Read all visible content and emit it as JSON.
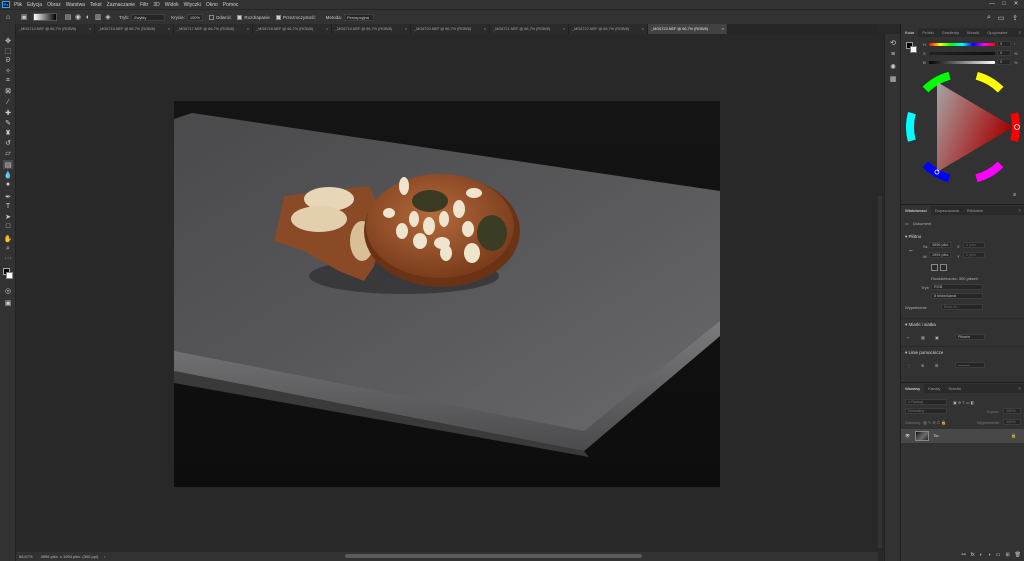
{
  "app": {
    "logo": "Ps"
  },
  "menu": [
    "Plik",
    "Edycja",
    "Obraz",
    "Warstwa",
    "Tekst",
    "Zaznaczanie",
    "Filtr",
    "3D",
    "Widok",
    "Wtyczki",
    "Okno",
    "Pomoc"
  ],
  "window_controls": [
    "—",
    "□",
    "✕"
  ],
  "options": {
    "mode_label": "Tryb:",
    "mode_value": "Zwykły",
    "opacity_label": "Krycie:",
    "opacity_value": "100%",
    "reverse_label": "Odwróć",
    "dither_label": "Rozdrapanie",
    "transparency_label": "Przezroczystość",
    "method_label": "Metoda:",
    "method_value": "Percepcyjna"
  },
  "tabs": [
    "_MG6714.NEF @ 66,7% (RGB/8)",
    "_MG6716.NEF @ 66,7% (RGB/8)",
    "_MG6717.NEF @ 66,7% (RGB/8)",
    "_MG6718.NEF @ 66,7% (RGB/8)",
    "_MG6719.NEF @ 66,7% (RGB/8)",
    "_MG6720.NEF @ 66,7% (RGB/8)",
    "_MG6721.NEF @ 66,7% (RGB/8)",
    "_MG6722.NEF @ 66,7% (RGB/8)",
    "_MG6723.NEF @ 66,7% (RGB/8)"
  ],
  "active_tab_index": 8,
  "status": {
    "zoom": "66,67%",
    "doc_size": "3996 pikx. x 1994 pikx. (300 ppi)",
    "arrow": "›"
  },
  "color_panel": {
    "tabs": [
      "Kolor",
      "Próbki",
      "Gradienty",
      "Wzorki",
      "Opcjonalne"
    ],
    "active": 0,
    "sliders": [
      {
        "label": "H",
        "value": "0"
      },
      {
        "label": "S",
        "value": "0"
      },
      {
        "label": "B",
        "value": "0"
      }
    ],
    "percent": "%"
  },
  "properties_panel": {
    "tabs": [
      "Właściwości",
      "Dopasowania",
      "Biblioteki"
    ],
    "active": 0,
    "doc_label": "Dokument",
    "canvas_section": "Płótno",
    "w_label": "Sz",
    "w_value": "3996 pikx.",
    "h_label": "W",
    "h_value": "1994 pikx.",
    "x_label": "X",
    "y_label": "Y",
    "x_value": "0 pikx.",
    "y_value": "0 pikx.",
    "resolution": "Rozdzielczość: 300 pikseli",
    "mode_label": "Tryb",
    "mode_value": "RGB",
    "depth_value": "8 bitów/kanał",
    "fill_label": "Wypełnienie",
    "fill_value": "Białe tło",
    "rulers_section": "Miarki i siatka",
    "rulers_value": "Piksele",
    "guides_section": "Linie pomocnicze"
  },
  "layers_panel": {
    "tabs": [
      "Warstwy",
      "Kanały",
      "Ścieżki"
    ],
    "active": 0,
    "search_placeholder": "Rodzaj",
    "blend_value": "Normalny",
    "opacity_label": "Krycie:",
    "opacity_value": "100%",
    "lock_label": "Zablokuj:",
    "fill_label": "Wypełnienie:",
    "fill_value": "100%",
    "layer_name": "Tło"
  },
  "colors": {
    "accent": "#31a8ff",
    "panel_bg": "#323232",
    "canvas_bg": "#282828",
    "active_tab": "#424242"
  }
}
